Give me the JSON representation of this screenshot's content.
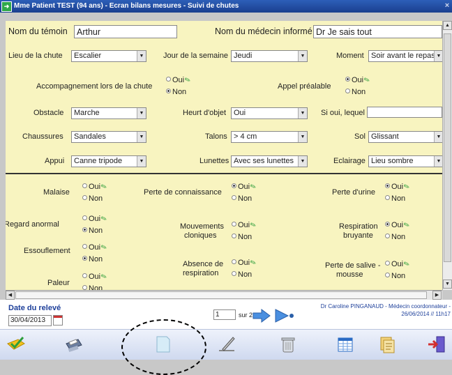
{
  "window": {
    "title": "Mme Patient TEST (94 ans) - Ecran bilans mesures - Suivi de chutes",
    "close": "×"
  },
  "fields": {
    "temoin": {
      "label": "Nom du témoin",
      "value": "Arthur"
    },
    "medecin": {
      "label": "Nom du médecin informé",
      "value": "Dr Je sais tout"
    },
    "lieu": {
      "label": "Lieu de la chute",
      "value": "Escalier"
    },
    "jour": {
      "label": "Jour de la semaine",
      "value": "Jeudi"
    },
    "moment": {
      "label": "Moment",
      "value": "Soir avant le repas"
    },
    "accompagnement": {
      "label": "Accompagnement lors de la chute",
      "selected": "Non"
    },
    "appel": {
      "label": "Appel préalable",
      "selected": "Oui"
    },
    "obstacle": {
      "label": "Obstacle",
      "value": "Marche"
    },
    "heurt": {
      "label": "Heurt d'objet",
      "value": "Oui"
    },
    "lequel": {
      "label": "Si oui, lequel",
      "value": ""
    },
    "chaussures": {
      "label": "Chaussures",
      "value": "Sandales"
    },
    "talons": {
      "label": "Talons",
      "value": "> 4 cm"
    },
    "sol": {
      "label": "Sol",
      "value": "Glissant"
    },
    "appui": {
      "label": "Appui",
      "value": "Canne tripode"
    },
    "lunettes": {
      "label": "Lunettes",
      "value": "Avec ses lunettes"
    },
    "eclairage": {
      "label": "Eclairage",
      "value": "Lieu sombre"
    }
  },
  "radio_opts": {
    "oui": "Oui",
    "non": "Non"
  },
  "symptoms": {
    "malaise": {
      "label": "Malaise",
      "selected": "none"
    },
    "perte_connaissance": {
      "label": "Perte de connaissance",
      "selected": "Oui"
    },
    "perte_urine": {
      "label": "Perte d'urine",
      "selected": "Oui"
    },
    "regard_anormal": {
      "label": "Regard anormal",
      "selected": "Non"
    },
    "mouvements": {
      "label1": "Mouvements",
      "label2": "cloniques",
      "selected": "none"
    },
    "respiration_bruyante": {
      "label1": "Respiration",
      "label2": "bruyante",
      "selected": "Oui"
    },
    "essoufflement": {
      "label": "Essouflement",
      "selected": "Non"
    },
    "absence_respiration": {
      "label1": "Absence de",
      "label2": "respiration",
      "selected": "none"
    },
    "perte_salive": {
      "label1": "Perte de salive -",
      "label2": "mousse",
      "selected": "none"
    },
    "paleur": {
      "label": "Paleur",
      "selected": "none"
    }
  },
  "footer": {
    "date_label": "Date du relevé",
    "date_value": "30/04/2013",
    "page_current": "1",
    "page_total": "sur 2",
    "author_line1": "Dr Caroline PINGANAUD - Médecin coordonnateur -",
    "author_line2": "26/06/2014 // 11h17"
  },
  "toolbar": {
    "icons": [
      "validate-icon",
      "print-icon",
      "blank-page-icon",
      "edit-pen-icon",
      "trash-icon",
      "table-icon",
      "documents-icon",
      "exit-icon"
    ]
  },
  "colors": {
    "form_bg": "#f8f4c0",
    "title_blue": "#1b3f8f",
    "label_blue": "#1d3f9a",
    "pen_green": "#2f9e3c"
  }
}
